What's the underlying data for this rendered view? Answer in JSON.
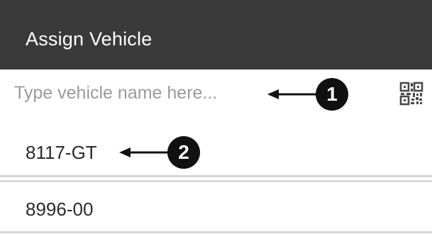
{
  "app_bar": {
    "title": "Assign Vehicle",
    "background": "#3a3a3a"
  },
  "search": {
    "placeholder": "Type vehicle name here...",
    "value": "",
    "scan_icon": "qr-code-icon"
  },
  "vehicles": [
    {
      "name": "8117-GT"
    },
    {
      "name": "8996-00"
    }
  ],
  "callouts": [
    {
      "number": "1",
      "target": "search-input"
    },
    {
      "number": "2",
      "target": "vehicle-list-item"
    }
  ]
}
